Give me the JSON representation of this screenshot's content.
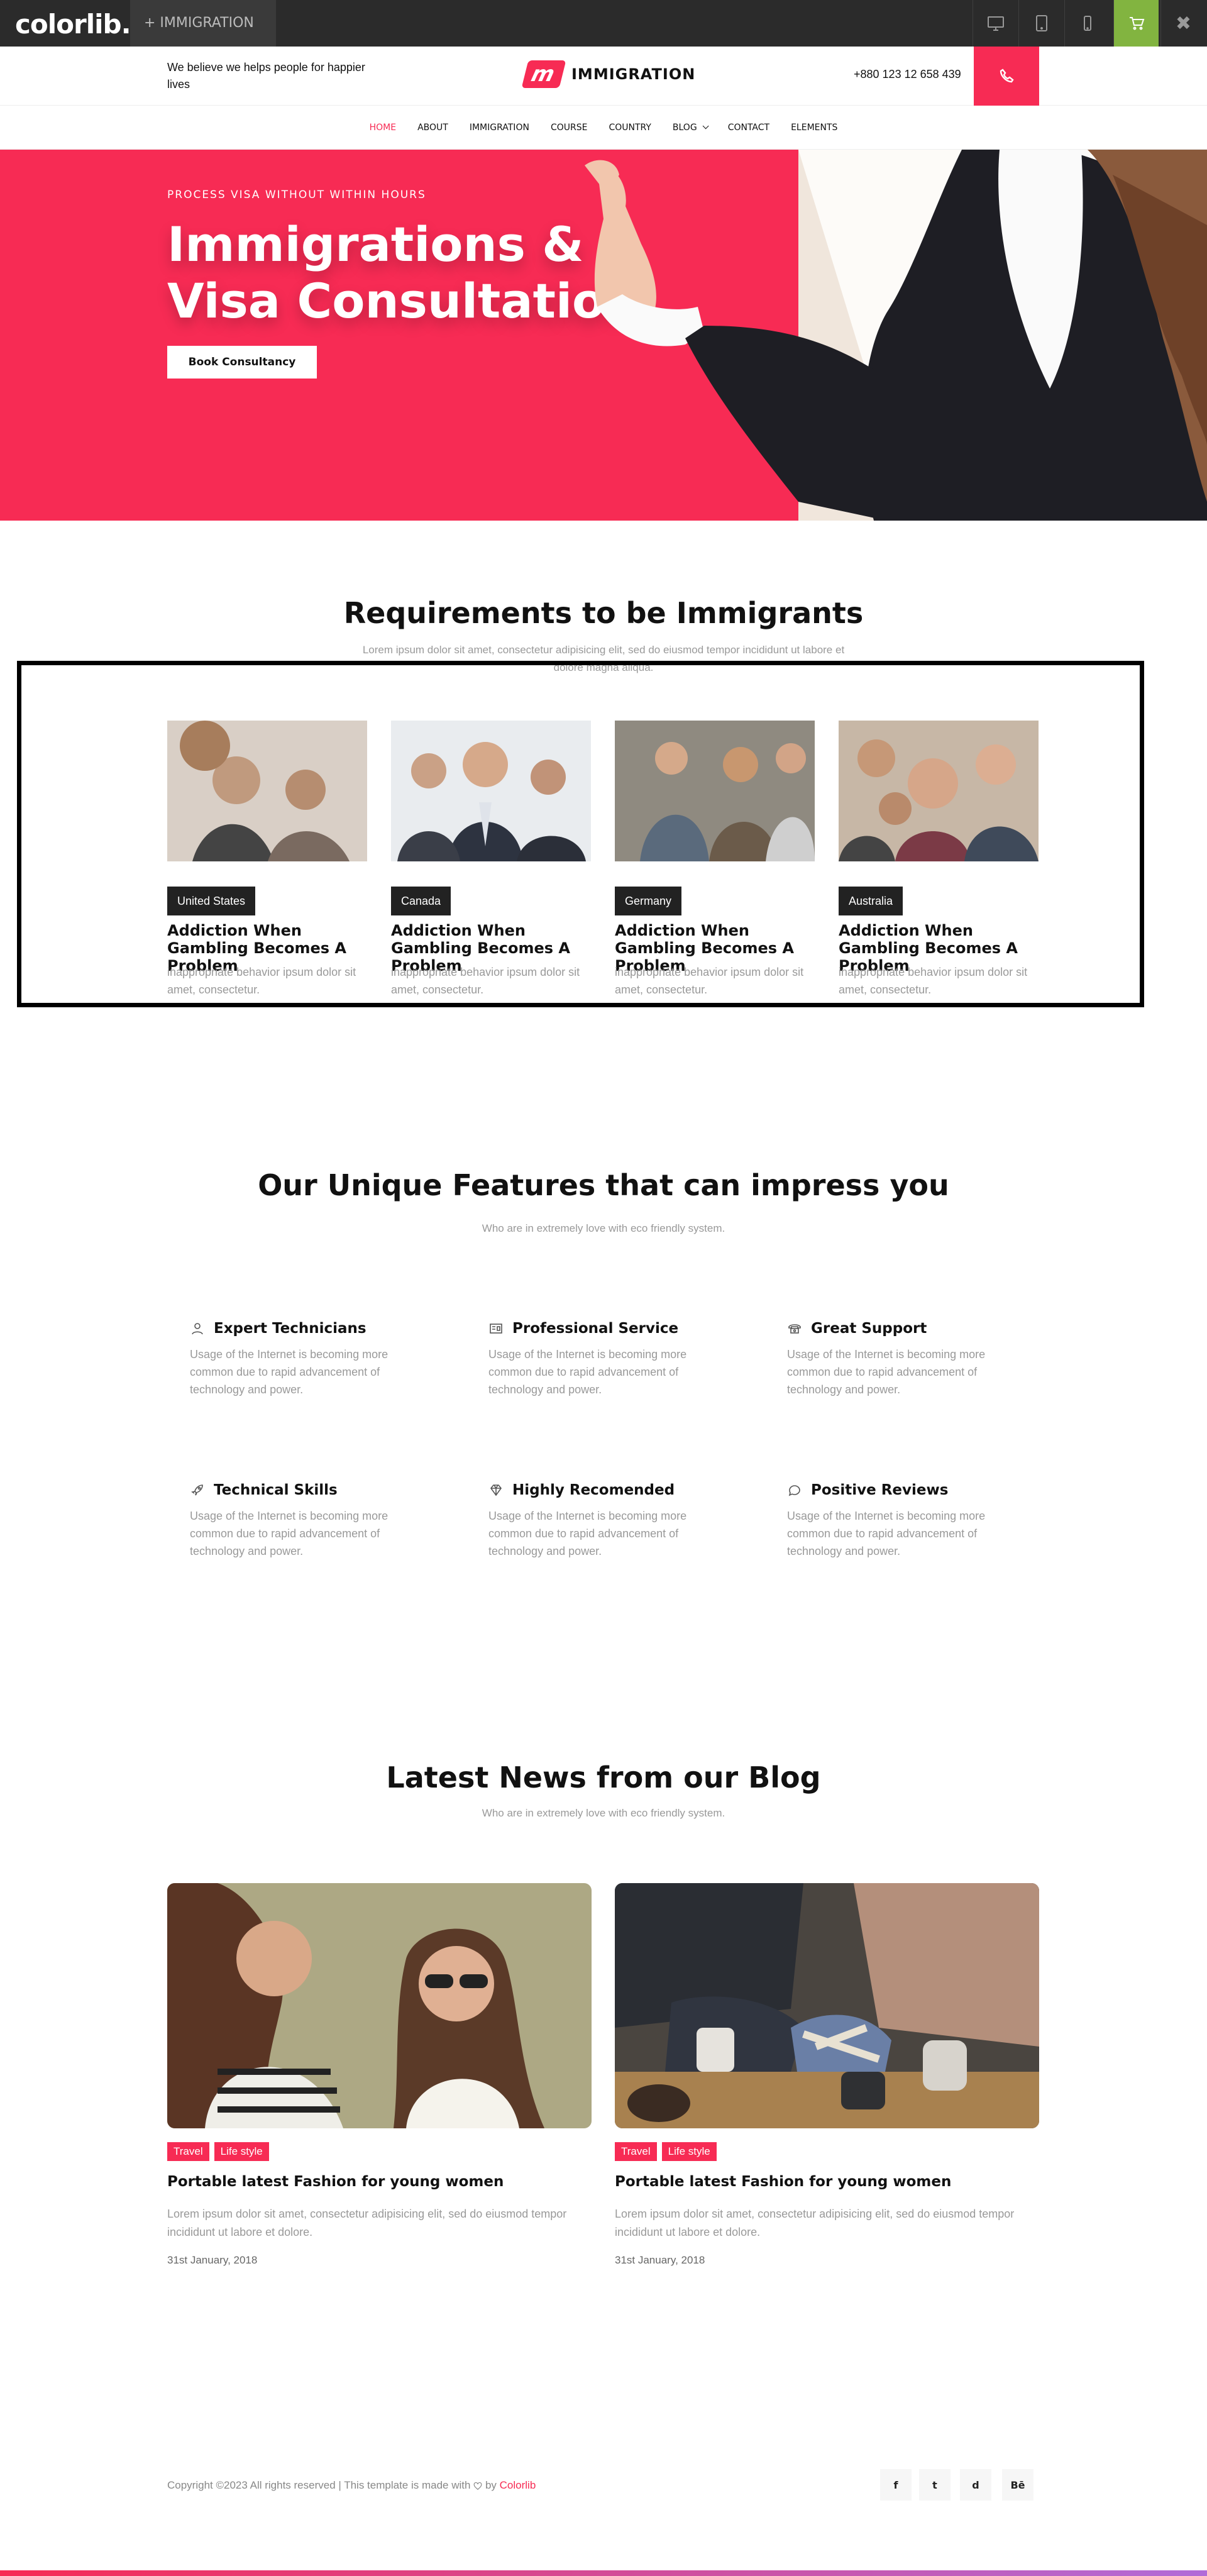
{
  "topbar": {
    "brand": "colorlib.",
    "tab_label": "+ IMMIGRATION",
    "close": "✖"
  },
  "header": {
    "tagline": "We believe we helps people for happier lives",
    "logo_text": "IMMIGRATION",
    "logo_mark": "m",
    "phone": "+880 123 12 658 439"
  },
  "nav": {
    "items": [
      "HOME",
      "ABOUT",
      "IMMIGRATION",
      "COURSE",
      "COUNTRY",
      "BLOG",
      "CONTACT",
      "ELEMENTS"
    ]
  },
  "hero": {
    "subtitle": "PROCESS VISA WITHOUT WITHIN HOURS",
    "title": "Immigrations & Visa Consultation",
    "button": "Book Consultancy"
  },
  "requirements": {
    "title": "Requirements to be Immigrants",
    "subtitle": "Lorem ipsum dolor sit amet, consectetur adipisicing elit, sed do eiusmod tempor incididunt ut labore et dolore magna aliqua.",
    "cards": [
      {
        "country": "United States",
        "title": "Addiction When Gambling Becomes A Problem",
        "desc": "inappropriate behavior ipsum dolor sit amet, consectetur."
      },
      {
        "country": "Canada",
        "title": "Addiction When Gambling Becomes A Problem",
        "desc": "inappropriate behavior ipsum dolor sit amet, consectetur."
      },
      {
        "country": "Germany",
        "title": "Addiction When Gambling Becomes A Problem",
        "desc": "inappropriate behavior ipsum dolor sit amet, consectetur."
      },
      {
        "country": "Australia",
        "title": "Addiction When Gambling Becomes A Problem",
        "desc": "inappropriate behavior ipsum dolor sit amet, consectetur."
      }
    ]
  },
  "features": {
    "title": "Our Unique Features that can impress you",
    "subtitle": "Who are in extremely love with eco friendly system.",
    "items": [
      {
        "title": "Expert Technicians",
        "desc": "Usage of the Internet is becoming more common due to rapid advancement of technology and power.",
        "icon": "user-icon"
      },
      {
        "title": "Professional Service",
        "desc": "Usage of the Internet is becoming more common due to rapid advancement of technology and power.",
        "icon": "license-icon"
      },
      {
        "title": "Great Support",
        "desc": "Usage of the Internet is becoming more common due to rapid advancement of technology and power.",
        "icon": "telephone-icon"
      },
      {
        "title": "Technical Skills",
        "desc": "Usage of the Internet is becoming more common due to rapid advancement of technology and power.",
        "icon": "rocket-icon"
      },
      {
        "title": "Highly Recomended",
        "desc": "Usage of the Internet is becoming more common due to rapid advancement of technology and power.",
        "icon": "diamond-icon"
      },
      {
        "title": "Positive Reviews",
        "desc": "Usage of the Internet is becoming more common due to rapid advancement of technology and power.",
        "icon": "bubble-icon"
      }
    ]
  },
  "blog": {
    "title": "Latest News from our Blog",
    "subtitle": "Who are in extremely love with eco friendly system.",
    "posts": [
      {
        "tags": [
          "Travel",
          "Life style"
        ],
        "title": "Portable latest Fashion for young women",
        "desc": "Lorem ipsum dolor sit amet, consectetur adipisicing elit, sed do eiusmod tempor incididunt ut labore et dolore.",
        "date": "31st January, 2018"
      },
      {
        "tags": [
          "Travel",
          "Life style"
        ],
        "title": "Portable latest Fashion for young women",
        "desc": "Lorem ipsum dolor sit amet, consectetur adipisicing elit, sed do eiusmod tempor incididunt ut labore et dolore.",
        "date": "31st January, 2018"
      }
    ]
  },
  "footer": {
    "copyright": "Copyright ©2023 All rights reserved | This template is made with",
    "by": "by",
    "brand": "Colorlib",
    "social": [
      "f",
      "t",
      "d",
      "Bē"
    ]
  },
  "colors": {
    "accent": "#f72b54",
    "topbar": "#2b2b2b",
    "cart": "#82b440"
  }
}
